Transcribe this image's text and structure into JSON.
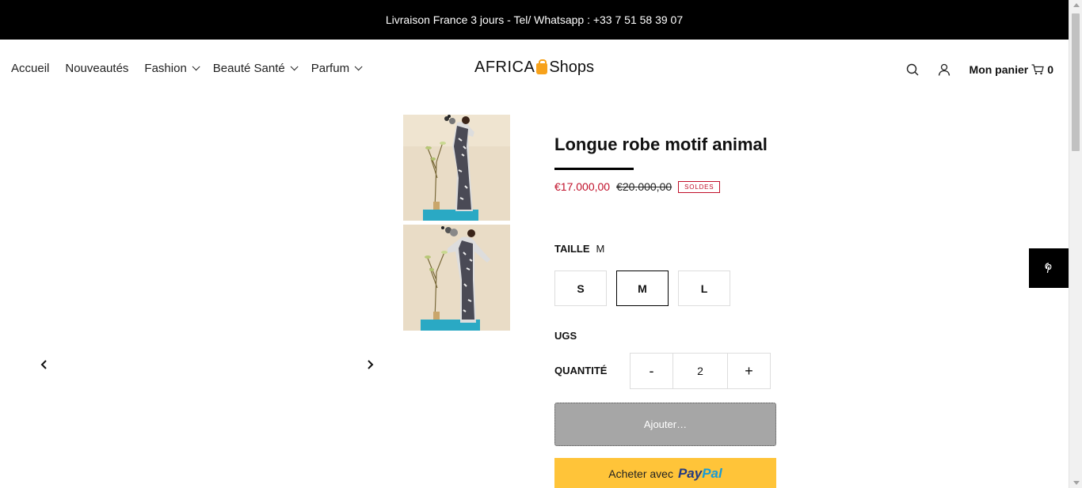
{
  "announcement": "Livraison France 3 jours - Tel/ Whatsapp : +33 7 51 58 39 07",
  "nav": {
    "items": [
      {
        "label": "Accueil",
        "has_dropdown": false
      },
      {
        "label": "Nouveautés",
        "has_dropdown": false
      },
      {
        "label": "Fashion",
        "has_dropdown": true
      },
      {
        "label": "Beauté Santé",
        "has_dropdown": true
      },
      {
        "label": "Parfum",
        "has_dropdown": true
      }
    ],
    "logo_left": "AFRICA",
    "logo_right": "Shops",
    "cart_label": "Mon panier",
    "cart_count": "0",
    "icons": [
      "search-icon",
      "account-icon",
      "cart-icon"
    ]
  },
  "product": {
    "title": "Longue robe motif animal",
    "price_sale": "€17.000,00",
    "price_original": "€20.000,00",
    "badge": "SOLDES",
    "size_label": "TAILLE",
    "size_selected": "M",
    "sizes": [
      "S",
      "M",
      "L"
    ],
    "ugs_label": "UGS",
    "quantity_label": "QUANTITÉ",
    "quantity_minus": "-",
    "quantity_value": "2",
    "quantity_plus": "+",
    "add_button": "Ajouter…",
    "paypal_prefix": "Acheter avec",
    "paypal_brand_1": "Pay",
    "paypal_brand_2": "Pal"
  },
  "colors": {
    "sale_red": "#c0102a",
    "logo_orange": "#f7a21b",
    "paypal_yellow": "#ffc439",
    "add_button_gray": "#a6a6a6"
  }
}
